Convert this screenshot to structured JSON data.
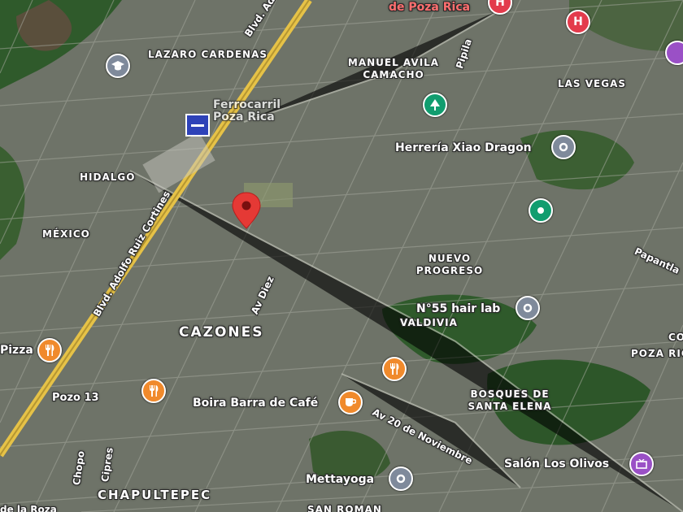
{
  "map": {
    "type": "satellite",
    "colors": {
      "base": "#6d7166",
      "vegetation": "#2f5a2b",
      "highway": "#e6c247",
      "marker": "#e53935"
    }
  },
  "labels": {
    "lazaro": "LAZARO CARDENAS",
    "manuel": "MANUEL AVILA CAMACHO",
    "lasvegas": "LAS VEGAS",
    "hidalgo": "HIDALGO",
    "mexico": "MÉXICO",
    "nuevo": "NUEVO PROGRESO",
    "valdivia": "VALDIVIA",
    "cazones": "CAZONES",
    "pozo13": "Pozo 13",
    "bosques": "BOSQUES DE SANTA ELENA",
    "chapultepec": "CHAPULTEPEC",
    "sanroman": "SAN ROMAN",
    "delaroz": "de la Roza",
    "pozarica_right": "POZA RICA",
    "co": "CO"
  },
  "roads": {
    "blvd_top": "Blvd. Adolfo Ruiz",
    "blvd_main": "Blvd. Adolfo Ruiz Cortines",
    "pipila": "Pipila",
    "av_diez": "Av Diez",
    "av20": "Av 20 de Noviembre",
    "papantla": "Papantla",
    "chopo": "Chopo",
    "cipres": "Cipres"
  },
  "places": {
    "pozarica_top": "de Poza Rica",
    "ferrocarril": "Ferrocarril Poza Rica",
    "herreria": "Herrería Xiao Dragon",
    "hairlab": "N°55 hair lab",
    "pizza": "Pizza",
    "boira": "Boira Barra de Café",
    "olivos": "Salón Los Olivos",
    "mettayoga": "Mettayoga"
  },
  "icons": {
    "school": "school-icon",
    "hospital": "hospital-icon",
    "park": "park-icon",
    "transit": "train-station-icon",
    "pin": "location-pin-icon",
    "food": "restaurant-icon",
    "cafe": "cafe-icon",
    "events": "event-venue-icon",
    "generic": "place-icon"
  }
}
